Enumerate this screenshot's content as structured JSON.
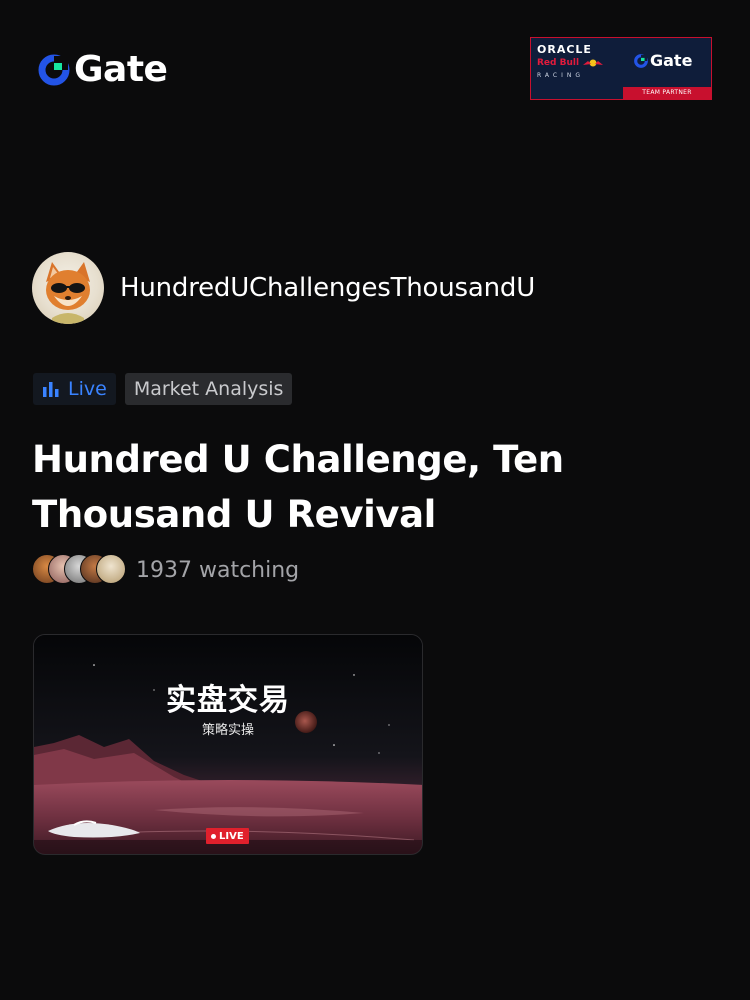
{
  "header": {
    "brand_name": "Gate",
    "brand_color": "#2354e6",
    "brand_accent": "#17e6a1",
    "partner_badge": {
      "oracle": "ORACLE",
      "redbull": "Red Bull",
      "racing": "RACING",
      "brand": "Gate",
      "footer": "TEAM PARTNER"
    }
  },
  "streamer": {
    "name": "HundredUChallengesThousandU",
    "avatar_icon": "fox-avatar"
  },
  "tags": {
    "live_label": "Live",
    "category_label": "Market Analysis",
    "live_color": "#3a83ff"
  },
  "stream": {
    "title": "Hundred U Challenge, Ten Thousand U Revival",
    "watching_text": "1937 watching"
  },
  "thumbnail": {
    "title": "实盘交易",
    "subtitle": "策略实操",
    "live_badge": "LIVE"
  }
}
